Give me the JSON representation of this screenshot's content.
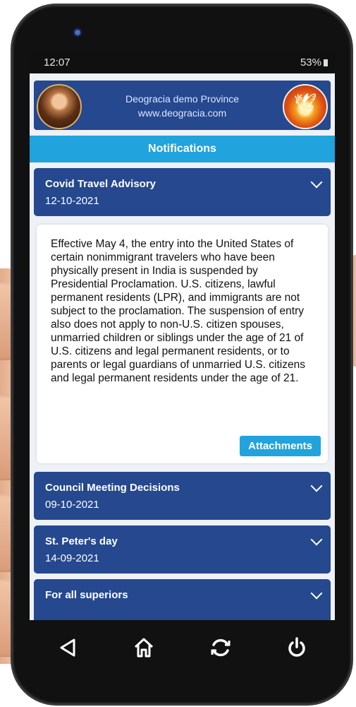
{
  "status_bar": {
    "time": "12:07",
    "battery": "53%"
  },
  "header": {
    "title": "Deogracia demo Province",
    "url": "www.deogracia.com"
  },
  "page_title": "Notifications",
  "notifications": [
    {
      "title": "Covid Travel Advisory",
      "date": "12-10-2021",
      "body": "Effective May 4, the entry into the United States of certain nonimmigrant travelers who have been physically present in India is suspended by Presidential Proclamation.  U.S. citizens, lawful permanent residents (LPR), and immigrants are not subject to the proclamation.  The suspension of entry also does not apply to non-U.S. citizen spouses, unmarried children or siblings under the age of 21 of U.S. citizens and legal permanent residents, or to parents or legal guardians of unmarried U.S. citizens and legal permanent residents under the age of 21.",
      "attachments_label": "Attachments"
    },
    {
      "title": "Council Meeting Decisions",
      "date": "09-10-2021"
    },
    {
      "title": "St. Peter's day",
      "date": "14-09-2021"
    },
    {
      "title": "For all superiors",
      "date": ""
    }
  ],
  "nav": {
    "back_icon": "back-triangle-icon",
    "home_icon": "home-icon",
    "refresh_icon": "refresh-icon",
    "power_icon": "power-icon"
  },
  "colors": {
    "header_blue": "#25488e",
    "accent_cyan": "#21a3dd"
  }
}
